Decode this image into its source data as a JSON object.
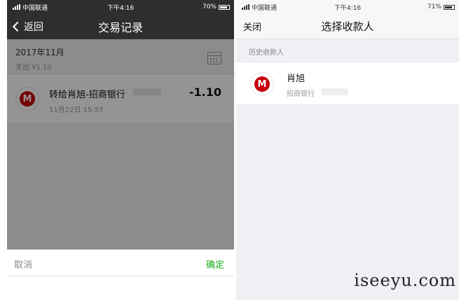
{
  "left_screen": {
    "status_bar": {
      "carrier": "中国联通",
      "time": "下午4:16",
      "battery": "70%"
    },
    "nav": {
      "back_label": "返回",
      "title": "交易记录"
    },
    "month_summary": {
      "month": "2017年11月",
      "spend": "支出 ¥1.10"
    },
    "transaction": {
      "description": "转给肖旭-招商银行",
      "date": "11月22日 15:57",
      "amount": "-1.10"
    },
    "action_sheet": {
      "cancel_label": "取消",
      "confirm_label": "确定"
    }
  },
  "right_screen": {
    "status_bar": {
      "carrier": "中国联通",
      "time": "下午4:16",
      "battery": "71%"
    },
    "nav": {
      "close_label": "关闭",
      "title": "选择收款人"
    },
    "section_header": "历史收款人",
    "payee": {
      "name": "肖旭",
      "bank": "招商银行"
    }
  },
  "watermark": "iseeyu.com",
  "icons": {
    "bank_logo": "china-merchants-bank-logo-icon",
    "bank_logo_letter": "M",
    "calendar": "calendar-icon",
    "back": "chevron-left-icon"
  },
  "colors": {
    "nav_dark": "#2e2e2e",
    "confirm_green": "#1aad19",
    "bank_red": "#c7000b"
  }
}
